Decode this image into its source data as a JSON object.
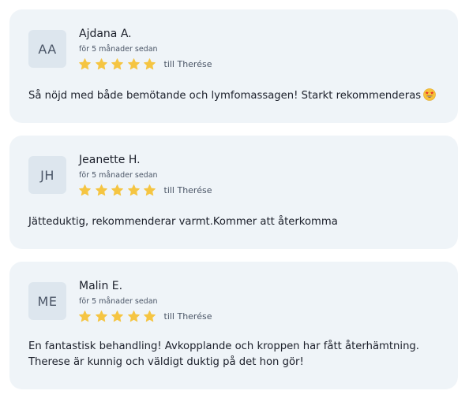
{
  "colors": {
    "card_background": "#eff4f8",
    "avatar_background": "#dde6ee",
    "star": "#f5c542"
  },
  "reviews": [
    {
      "initials": "AA",
      "name": "Ajdana A.",
      "time": "för 5 månader sedan",
      "rating": 5,
      "target": "till Therése",
      "text": "Så nöjd med både bemötande och lymfomassagen! Starkt rekommenderas",
      "emoji": "star-struck-emoji"
    },
    {
      "initials": "JH",
      "name": "Jeanette H.",
      "time": "för 5 månader sedan",
      "rating": 5,
      "target": "till Therése",
      "text": "Jätteduktig, rekommenderar varmt.Kommer att återkomma"
    },
    {
      "initials": "ME",
      "name": "Malin E.",
      "time": "för 5 månader sedan",
      "rating": 5,
      "target": "till Therése",
      "text": "En fantastisk behandling! Avkopplande och kroppen har fått återhämtning. Therese är kunnig och väldigt duktig på det hon gör!"
    }
  ]
}
